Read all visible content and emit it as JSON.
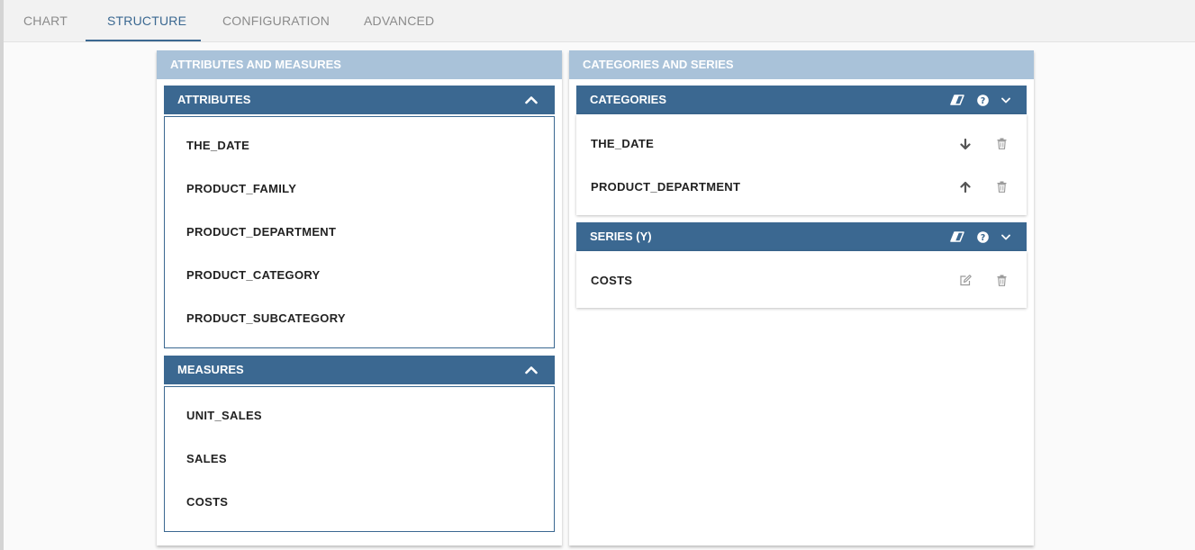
{
  "tabs": [
    {
      "label": "CHART",
      "active": false
    },
    {
      "label": "STRUCTURE",
      "active": true
    },
    {
      "label": "CONFIGURATION",
      "active": false
    },
    {
      "label": "ADVANCED",
      "active": false
    }
  ],
  "left_panel": {
    "title": "ATTRIBUTES AND MEASURES",
    "attributes": {
      "title": "ATTRIBUTES",
      "collapse_icon": "chevron-up-icon",
      "items": [
        "THE_DATE",
        "PRODUCT_FAMILY",
        "PRODUCT_DEPARTMENT",
        "PRODUCT_CATEGORY",
        "PRODUCT_SUBCATEGORY"
      ]
    },
    "measures": {
      "title": "MEASURES",
      "collapse_icon": "chevron-up-icon",
      "items": [
        "UNIT_SALES",
        "SALES",
        "COSTS"
      ]
    }
  },
  "right_panel": {
    "title": "CATEGORIES AND SERIES",
    "categories": {
      "title": "CATEGORIES",
      "header_icons": [
        "eraser-icon",
        "help-icon",
        "chevron-down-icon"
      ],
      "items": [
        {
          "label": "THE_DATE",
          "action_icon": "arrow-down-icon",
          "delete_icon": "trash-icon"
        },
        {
          "label": "PRODUCT_DEPARTMENT",
          "action_icon": "arrow-up-icon",
          "delete_icon": "trash-icon"
        }
      ]
    },
    "series": {
      "title": "SERIES (Y)",
      "header_icons": [
        "eraser-icon",
        "help-icon",
        "chevron-down-icon"
      ],
      "items": [
        {
          "label": "COSTS",
          "action_icon": "edit-icon",
          "delete_icon": "trash-icon"
        }
      ]
    }
  },
  "colors": {
    "accent": "#3b6891",
    "panel_header": "#a9c2d9",
    "tab_inactive": "#8b8b8b"
  }
}
